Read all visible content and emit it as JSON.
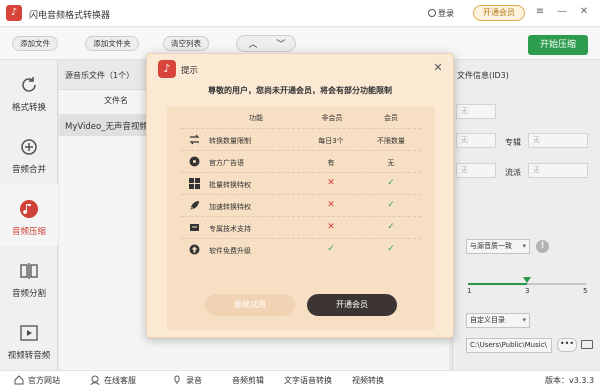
{
  "app": {
    "title": "闪电音频格式转换器",
    "logo_glyph": "♪"
  },
  "titlebar": {
    "login": "登录",
    "vip": "开通会员",
    "controls": [
      "≡",
      "—",
      "✕"
    ]
  },
  "toolbar": {
    "add_file": "添加文件",
    "add_folder": "添加文件夹",
    "clear_list": "清空列表",
    "up": "︿",
    "down": "﹀",
    "start": "开始压缩"
  },
  "sidebar": {
    "items": [
      {
        "label": "格式转换",
        "icon": "refresh-icon"
      },
      {
        "label": "音频合并",
        "icon": "merge-icon"
      },
      {
        "label": "音频压缩",
        "icon": "compress-icon",
        "active": true
      },
      {
        "label": "音频分割",
        "icon": "split-icon"
      },
      {
        "label": "视频转音频",
        "icon": "video-icon"
      }
    ]
  },
  "filelist": {
    "header": "源音乐文件（1个）",
    "column": "文件名",
    "rows": [
      "MyVideo_无声音视频"
    ]
  },
  "rpanel": {
    "title": "文件信息(ID3)",
    "placeholder": "无",
    "album_label": "专辑",
    "genre_label": "流派",
    "quality_select": "与源音质一致",
    "ticks": [
      "1",
      "3",
      "5"
    ],
    "slider_value": 3,
    "slider_max": 5,
    "dir_select": "自定义目录",
    "path": "C:\\Users\\Public\\Music\\",
    "more": "•••"
  },
  "dialog": {
    "title": "提示",
    "subtitle": "尊敬的用户，您尚未开通会员，将会有部分功能限制",
    "head": {
      "feature": "功能",
      "free": "非会员",
      "vip": "会员"
    },
    "rows": [
      {
        "feature": "转换数量限制",
        "free": "每日3个",
        "vip": "不限数量",
        "icon": "swap-icon"
      },
      {
        "feature": "官方广告语",
        "free": "有",
        "vip": "无",
        "icon": "music-disc-icon"
      },
      {
        "feature": "批量转换特权",
        "free": "✕",
        "vip": "✓",
        "icon": "grid-icon"
      },
      {
        "feature": "加速转换特权",
        "free": "✕",
        "vip": "✓",
        "icon": "rocket-icon"
      },
      {
        "feature": "专属技术支持",
        "free": "✕",
        "vip": "✓",
        "icon": "support-icon"
      },
      {
        "feature": "软件免费升级",
        "free": "✓",
        "vip": "✓",
        "icon": "upgrade-icon"
      }
    ],
    "try_btn": "继续试用",
    "vip_btn": "开通会员"
  },
  "bottombar": {
    "items": [
      {
        "label": "官方网站",
        "icon": "home-icon"
      },
      {
        "label": "在线客服",
        "icon": "headset-icon"
      },
      {
        "label": "录音",
        "icon": "mic-icon"
      },
      {
        "label": "音频剪辑",
        "icon": ""
      },
      {
        "label": "文字语音转换",
        "icon": ""
      },
      {
        "label": "视频转换",
        "icon": ""
      }
    ],
    "version": "版本：v3.3.3"
  },
  "colors": {
    "brand_red": "#d9443a",
    "green": "#2e9c4d",
    "dialog_bg": "#fbe9d4"
  }
}
